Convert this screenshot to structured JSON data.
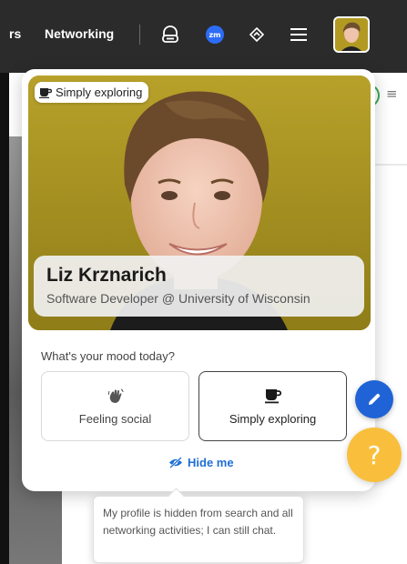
{
  "topbar": {
    "truncated_link": "rs",
    "networking_label": "Networking",
    "icons": [
      "headset-icon",
      "zoom-icon",
      "diamond-icon",
      "menu-icon"
    ],
    "zoom_badge": "zm",
    "avatar": "user-avatar"
  },
  "profile": {
    "status_tag": "Simply exploring",
    "name": "Liz Krznarich",
    "title": "Software Developer @ University of Wisconsin"
  },
  "mood": {
    "question": "What's your mood today?",
    "options": [
      {
        "label": "Feeling social",
        "icon": "waving-hand-icon",
        "selected": false
      },
      {
        "label": "Simply exploring",
        "icon": "coffee-cup-icon",
        "selected": true
      }
    ]
  },
  "hide_me": {
    "label": "Hide me",
    "icon": "eye-slash-icon"
  },
  "tooltip": {
    "text": "My profile is hidden from search and all networking activities; I can still chat."
  },
  "fab": {
    "edit_icon": "pencil-icon",
    "help_label": "?"
  },
  "colors": {
    "topbar": "#2b2b2b",
    "accent_blue": "#1f63d6",
    "zoom_blue": "#2d6cf5",
    "help_yellow": "#f9bf3c",
    "photo_background": "#b09a24",
    "online_green": "#3aa757"
  }
}
